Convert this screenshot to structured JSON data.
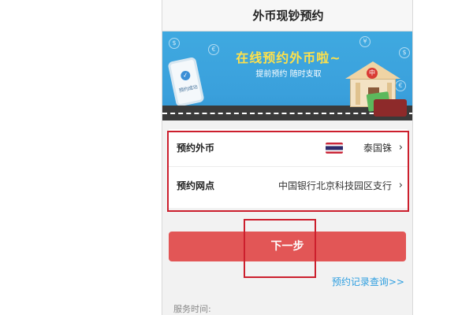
{
  "page": {
    "title": "外币现钞预约"
  },
  "banner": {
    "headline": "在线预约外币啦~",
    "subline": "提前预约   随时支取",
    "phone_label": "预约成功",
    "bank_logo": "中",
    "coin_glyphs": [
      "$",
      "€",
      "¥",
      "$",
      "€"
    ],
    "check_icon": "✓"
  },
  "form": {
    "currency": {
      "label": "预约外币",
      "value": "泰国铢",
      "flag_icon": "thailand-flag",
      "chevron": "›"
    },
    "branch": {
      "label": "预约网点",
      "value": "中国银行北京科技园区支行",
      "chevron": "›"
    }
  },
  "actions": {
    "next_label": "下一步",
    "record_link": "预约记录查询>>"
  },
  "footer": {
    "service_time_label": "服务时间:"
  },
  "colors": {
    "highlight_box": "#cc1f2d",
    "primary_button": "#e25656",
    "link": "#2f9fe0",
    "banner_sky": "#3fa9e0"
  }
}
